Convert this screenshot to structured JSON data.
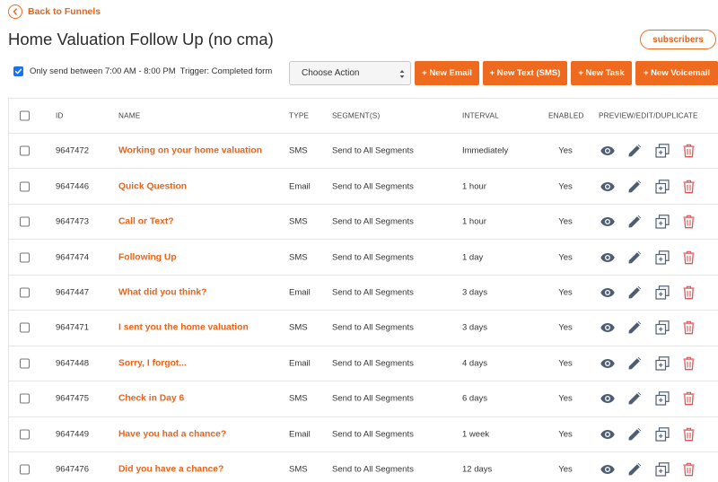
{
  "back_label": "Back to Funnels",
  "page_title": "Home Valuation Follow Up (no cma)",
  "subscribers_label": "subscribers",
  "send_window": {
    "label": "Only send between 7:00 AM - 8:00 PM",
    "trigger": "Trigger: Completed form"
  },
  "action_select": {
    "value": "Choose Action"
  },
  "buttons": {
    "new_email": "+ New Email",
    "new_text": "+ New Text (SMS)",
    "new_task": "+ New Task",
    "new_voicemail": "+ New Voicemail"
  },
  "table": {
    "headers": {
      "id": "ID",
      "name": "NAME",
      "type": "TYPE",
      "segments": "SEGMENT(S)",
      "interval": "INTERVAL",
      "enabled": "ENABLED",
      "actions": "PREVIEW/EDIT/DUPLICATE"
    },
    "rows": [
      {
        "id": "9647472",
        "name": "Working on your home valuation",
        "type": "SMS",
        "segments": "Send to All Segments",
        "interval": "Immediately",
        "enabled": "Yes"
      },
      {
        "id": "9647446",
        "name": "Quick Question",
        "type": "Email",
        "segments": "Send to All Segments",
        "interval": "1 hour",
        "enabled": "Yes"
      },
      {
        "id": "9647473",
        "name": "Call or Text?",
        "type": "SMS",
        "segments": "Send to All Segments",
        "interval": "1 hour",
        "enabled": "Yes"
      },
      {
        "id": "9647474",
        "name": "Following Up",
        "type": "SMS",
        "segments": "Send to All Segments",
        "interval": "1 day",
        "enabled": "Yes"
      },
      {
        "id": "9647447",
        "name": "What did you think?",
        "type": "Email",
        "segments": "Send to All Segments",
        "interval": "3 days",
        "enabled": "Yes"
      },
      {
        "id": "9647471",
        "name": "I sent you the home valuation",
        "type": "SMS",
        "segments": "Send to All Segments",
        "interval": "3 days",
        "enabled": "Yes"
      },
      {
        "id": "9647448",
        "name": "Sorry, I forgot...",
        "type": "Email",
        "segments": "Send to All Segments",
        "interval": "4 days",
        "enabled": "Yes"
      },
      {
        "id": "9647475",
        "name": "Check in Day 6",
        "type": "SMS",
        "segments": "Send to All Segments",
        "interval": "6 days",
        "enabled": "Yes"
      },
      {
        "id": "9647449",
        "name": "Have you had a chance?",
        "type": "Email",
        "segments": "Send to All Segments",
        "interval": "1 week",
        "enabled": "Yes"
      },
      {
        "id": "9647476",
        "name": "Did you have a chance?",
        "type": "SMS",
        "segments": "Send to All Segments",
        "interval": "12 days",
        "enabled": "Yes"
      }
    ]
  },
  "row_icons": [
    "eye-icon",
    "pencil-icon",
    "duplicate-icon",
    "trash-icon"
  ],
  "colors": {
    "accent": "#ee6a1f",
    "checkbox_blue": "#1a73e8",
    "icon_gray": "#4f5d73",
    "delete_red": "#e05555"
  }
}
